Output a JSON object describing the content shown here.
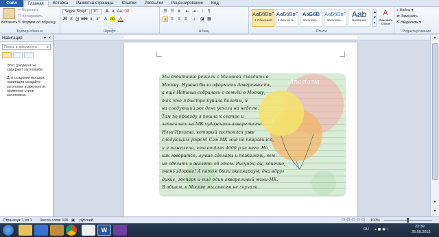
{
  "tabs": [
    "Файл",
    "Главная",
    "Вставка",
    "Разметка страницы",
    "Ссылки",
    "Рассылки",
    "Рецензирование",
    "Вид"
  ],
  "clipboard": {
    "paste": "Вставить",
    "cut": "Вырезать",
    "copy": "Копировать",
    "format": "Формат по образцу",
    "label": "Буфер обмена"
  },
  "font": {
    "name": "Segoe Script",
    "size": "10",
    "label": "Шрифт"
  },
  "paragraph": {
    "label": "Абзац"
  },
  "styles": {
    "label": "Стили",
    "items": [
      {
        "preview": "АаБбВвГг,",
        "name": "1 Обычный"
      },
      {
        "preview": "АаБбВвГг,",
        "name": "1 Без инте..."
      },
      {
        "preview": "АаБбВ",
        "name": "Заголово..."
      },
      {
        "preview": "АаБбВвГ",
        "name": "Заголово..."
      },
      {
        "preview": "Aab",
        "name": "Название"
      }
    ],
    "change": "Изменить стили"
  },
  "editing": {
    "find": "Найти",
    "replace": "Заменить",
    "select": "Выделить",
    "label": "Редактирование"
  },
  "nav": {
    "title": "Навигация",
    "search_placeholder": "Поиск в документе",
    "msg1": "Этот документ не содержит заголовков.",
    "msg2": "Для создания вкладок навигации создайте заголовки в документе, применив стили заголовков."
  },
  "letter": {
    "watermark": "Anastasia",
    "lines": [
      "Мы спонтанно решили с Миланой съездить в",
      "Москву. Нужно было оформить доверенность,",
      "а ещё Наташа собралась с семьёй в Москву,",
      "так что я быстро купила билеты, и",
      "на следующий же день уехала на неделю.",
      "Там по приезду я пошла к сестре и",
      "записалась на МК художника-акварелиста",
      "Ильи Иргаева, который состоялся уже",
      "следующим утром! Сам МК мне не понравился,",
      "и я пожалела, что отдала 4000 р за него. Но,",
      "как говорится, лучше сделать и пожалеть, чем",
      "не сделать и жалеть об этом. Рисунок, он, конечно,",
      "очень здорово! А потом были океанариум, дни вдруг",
      "дикие, зоопарк и ещё один акварельный мини-МК.",
      "В общем, в Москве мы совсем не скучали."
    ]
  },
  "status": {
    "page": "Страница: 1 из 1",
    "words": "Число слов: 106",
    "lang": "русский",
    "zoom": "100%"
  },
  "taskbar": {
    "time": "22:39",
    "date": "26.09.2015",
    "lang": "RU"
  },
  "colors": {
    "file_tab": "#2a5daa",
    "balloon_yellow": "#f3e36a",
    "balloon_orange": "#f5b364",
    "balloon_pink": "#f2a7a7",
    "letter_bg": "#d9ecd8"
  }
}
